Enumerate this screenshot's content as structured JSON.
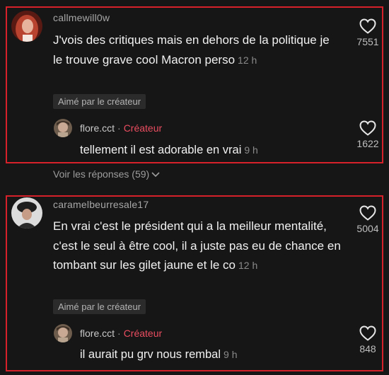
{
  "comments": [
    {
      "username": "callmewill0w",
      "text": "J'vois des critiques mais en dehors de la politique je le trouve grave cool Macron perso",
      "time": "12 h",
      "badge": "Aimé par le créateur",
      "likes": "7551",
      "reply": {
        "username": "flore.cct",
        "separator": "·",
        "role": "Créateur",
        "text": "tellement il est adorable en vrai",
        "time": "9 h",
        "likes": "1622"
      },
      "view_replies": "Voir les réponses (59)"
    },
    {
      "username": "caramelbeurresale17",
      "text": "En vrai c'est le président qui a la meilleur mentalité, c'est le seul à être cool, il a juste pas eu de chance en tombant sur les gilet jaune et le co",
      "time": "12 h",
      "badge": "Aimé par le créateur",
      "likes": "5004",
      "reply": {
        "username": "flore.cct",
        "separator": "·",
        "role": "Créateur",
        "text": "il aurait pu grv nous rembal",
        "time": "9 h",
        "likes": "848"
      }
    }
  ],
  "colors": {
    "highlight_border": "#d6202a",
    "creator": "#ea4d60",
    "background": "#161616"
  }
}
